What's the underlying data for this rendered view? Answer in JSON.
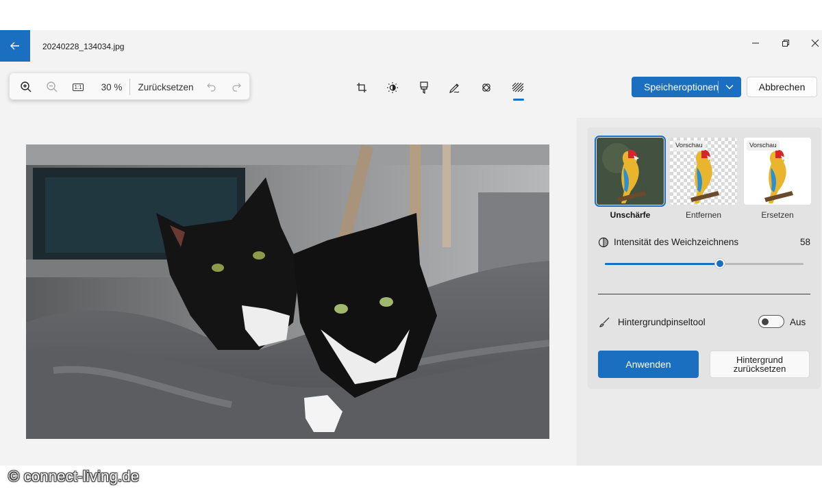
{
  "window": {
    "filename": "20240228_134034.jpg"
  },
  "zoom_toolbar": {
    "zoom_level": "30 %",
    "reset_label": "Zurücksetzen",
    "actual_size_label": "1:1"
  },
  "tools": [
    {
      "name": "crop-tool",
      "icon": "crop-icon"
    },
    {
      "name": "adjust-tool",
      "icon": "brightness-icon"
    },
    {
      "name": "filter-tool",
      "icon": "filter-icon"
    },
    {
      "name": "markup-tool",
      "icon": "pen-icon"
    },
    {
      "name": "retouch-tool",
      "icon": "retouch-icon"
    },
    {
      "name": "background-tool",
      "icon": "background-blur-icon",
      "active": true
    }
  ],
  "actions": {
    "save_options": "Speicheroptionen",
    "cancel": "Abbrechen"
  },
  "background_panel": {
    "options": [
      {
        "label": "Unschärfe",
        "badge": "",
        "selected": true
      },
      {
        "label": "Entfernen",
        "badge": "Vorschau",
        "selected": false
      },
      {
        "label": "Ersetzen",
        "badge": "Vorschau",
        "selected": false
      }
    ],
    "intensity_label": "Intensität des Weichzeichnens",
    "intensity_value": "58",
    "intensity_fraction": 0.58,
    "brush_tool_label": "Hintergrundpinseltool",
    "brush_tool_state": "Aus",
    "apply": "Anwenden",
    "reset_background": "Hintergrund zurücksetzen"
  },
  "colors": {
    "accent": "#1a6fc0",
    "app_background": "#f3f3f3",
    "panel_background": "#ebebeb"
  },
  "watermark": "© connect-living.de"
}
